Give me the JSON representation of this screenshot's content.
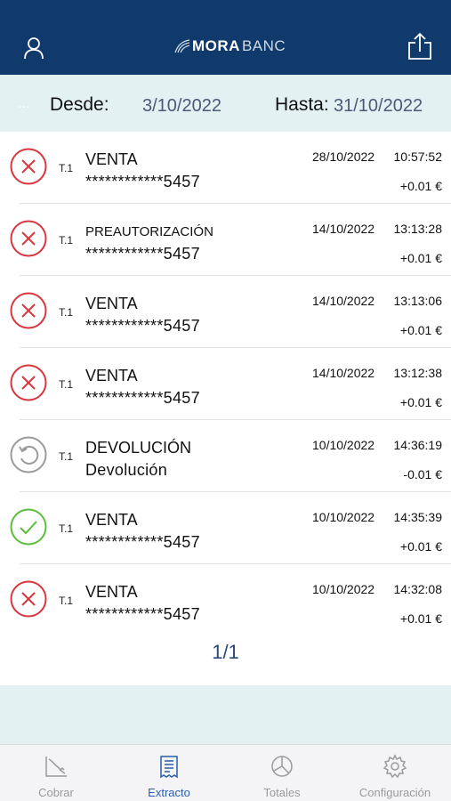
{
  "header": {
    "logo_bold": "MORA",
    "logo_thin": "BANC",
    "user_icon": "user-icon",
    "share_icon": "share-icon"
  },
  "filter": {
    "ellipsis": "...",
    "from_label": "Desde:",
    "from_value": "3/10/2022",
    "to_label": "Hasta:",
    "to_value": "31/10/2022"
  },
  "transactions": [
    {
      "status": "failed",
      "terminal": "T.1",
      "type": "VENTA",
      "detail": "************5457",
      "date": "28/10/2022",
      "time": "10:57:52",
      "amount": "+0.01 €"
    },
    {
      "status": "failed",
      "terminal": "T.1",
      "type": "PREAUTORIZACIÓN",
      "detail": "************5457",
      "date": "14/10/2022",
      "time": "13:13:28",
      "amount": "+0.01 €"
    },
    {
      "status": "failed",
      "terminal": "T.1",
      "type": "VENTA",
      "detail": "************5457",
      "date": "14/10/2022",
      "time": "13:13:06",
      "amount": "+0.01 €"
    },
    {
      "status": "failed",
      "terminal": "T.1",
      "type": "VENTA",
      "detail": "************5457",
      "date": "14/10/2022",
      "time": "13:12:38",
      "amount": "+0.01 €"
    },
    {
      "status": "refund",
      "terminal": "T.1",
      "type": "DEVOLUCIÓN",
      "detail": "Devolución",
      "date": "10/10/2022",
      "time": "14:36:19",
      "amount": "-0.01 €"
    },
    {
      "status": "success",
      "terminal": "T.1",
      "type": "VENTA",
      "detail": "************5457",
      "date": "10/10/2022",
      "time": "14:35:39",
      "amount": "+0.01 €"
    },
    {
      "status": "failed",
      "terminal": "T.1",
      "type": "VENTA",
      "detail": "************5457",
      "date": "10/10/2022",
      "time": "14:32:08",
      "amount": "+0.01 €"
    }
  ],
  "pager": "1/1",
  "tabs": [
    {
      "label": "Cobrar",
      "icon": "chart-decline-icon",
      "active": false
    },
    {
      "label": "Extracto",
      "icon": "receipt-icon",
      "active": true
    },
    {
      "label": "Totales",
      "icon": "pie-chart-icon",
      "active": false
    },
    {
      "label": "Configuración",
      "icon": "gear-icon",
      "active": false
    }
  ],
  "colors": {
    "header": "#0f3a6b",
    "failed": "#d9363e",
    "success": "#5bbd3c",
    "refund": "#9b9b9b",
    "tab_active": "#2a5ea8",
    "tab_inactive": "#9a9a9a"
  }
}
